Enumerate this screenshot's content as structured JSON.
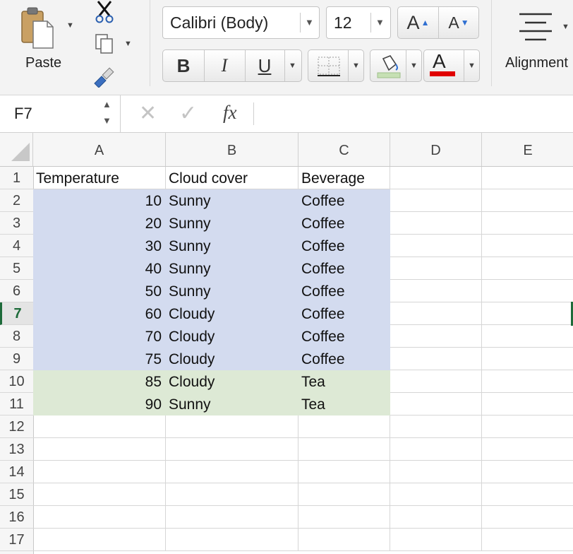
{
  "ribbon": {
    "paste_label": "Paste",
    "font_name": "Calibri (Body)",
    "font_size": "12",
    "grow_font_label": "A",
    "shrink_font_label": "A",
    "bold_label": "B",
    "italic_label": "I",
    "underline_label": "U",
    "font_color_label": "A",
    "font_color": "#e00000",
    "alignment_label": "Alignment"
  },
  "formula_bar": {
    "name_box": "F7",
    "fx_label": "fx",
    "formula": ""
  },
  "sheet": {
    "columns": [
      "A",
      "B",
      "C",
      "D",
      "E"
    ],
    "rows": [
      "1",
      "2",
      "3",
      "4",
      "5",
      "6",
      "7",
      "8",
      "9",
      "10",
      "11",
      "12",
      "13",
      "14",
      "15",
      "16",
      "17"
    ],
    "active_row": "7",
    "header": {
      "a": "Temperature",
      "b": "Cloud cover",
      "c": "Beverage"
    },
    "data": [
      {
        "a": "10",
        "b": "Sunny",
        "c": "Coffee"
      },
      {
        "a": "20",
        "b": "Sunny",
        "c": "Coffee"
      },
      {
        "a": "30",
        "b": "Sunny",
        "c": "Coffee"
      },
      {
        "a": "40",
        "b": "Sunny",
        "c": "Coffee"
      },
      {
        "a": "50",
        "b": "Sunny",
        "c": "Coffee"
      },
      {
        "a": "60",
        "b": "Cloudy",
        "c": "Coffee"
      },
      {
        "a": "70",
        "b": "Cloudy",
        "c": "Coffee"
      },
      {
        "a": "75",
        "b": "Cloudy",
        "c": "Coffee"
      },
      {
        "a": "85",
        "b": "Cloudy",
        "c": "Tea"
      },
      {
        "a": "90",
        "b": "Sunny",
        "c": "Tea"
      }
    ],
    "highlight_colors": {
      "coffee": "#d3dbef",
      "tea": "#dde9d5"
    }
  }
}
